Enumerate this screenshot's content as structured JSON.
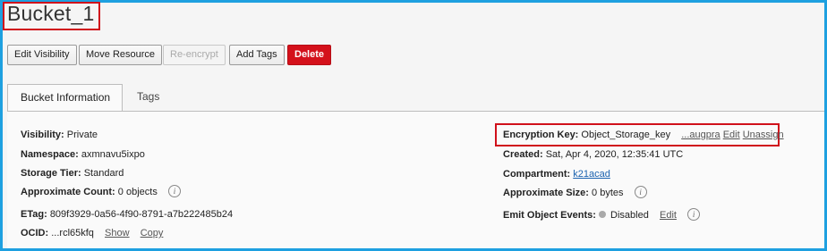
{
  "page": {
    "title": "Bucket_1"
  },
  "toolbar": {
    "edit_visibility": "Edit Visibility",
    "move_resource": "Move Resource",
    "re_encrypt": "Re-encrypt",
    "add_tags": "Add Tags",
    "delete": "Delete"
  },
  "tabs": {
    "bucket_information": "Bucket Information",
    "tags": "Tags"
  },
  "info_left": {
    "visibility_label": "Visibility:",
    "visibility_value": "Private",
    "namespace_label": "Namespace:",
    "namespace_value": "axmnavu5ixpo",
    "storage_tier_label": "Storage Tier:",
    "storage_tier_value": "Standard",
    "approx_count_label": "Approximate Count:",
    "approx_count_value": "0 objects",
    "etag_label": "ETag:",
    "etag_value": "809f3929-0a56-4f90-8791-a7b222485b24",
    "ocid_label": "OCID:",
    "ocid_value": "...rcl65kfq",
    "ocid_show": "Show",
    "ocid_copy": "Copy"
  },
  "info_right": {
    "encryption_key_label": "Encryption Key:",
    "encryption_key_value": "Object_Storage_key",
    "encryption_key_link": "...augpra",
    "encryption_edit": "Edit",
    "encryption_unassign": "Unassign",
    "created_label": "Created:",
    "created_value": "Sat, Apr 4, 2020, 12:35:41 UTC",
    "compartment_label": "Compartment:",
    "compartment_value": "k21acad",
    "approx_size_label": "Approximate Size:",
    "approx_size_value": "0 bytes",
    "emit_events_label": "Emit Object Events:",
    "emit_events_value": "Disabled",
    "emit_events_edit": "Edit"
  },
  "icons": {
    "info": "i"
  },
  "colors": {
    "frame_border": "#1ea0e0",
    "highlight_border": "#d0101b",
    "delete_button": "#d4111b",
    "link_blue": "#1a62b0",
    "status_disabled": "#a9a9a9"
  }
}
